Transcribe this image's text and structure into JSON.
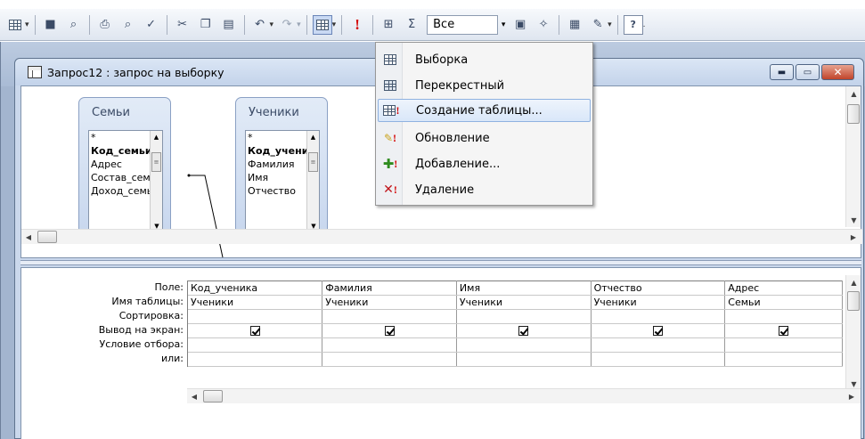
{
  "toolbar": {
    "combo_value": "Все",
    "sigma": "Σ",
    "exclaim": "!",
    "help": "?",
    "dropdown_arrow": "▾"
  },
  "menu": {
    "items": [
      {
        "label": "Выборка",
        "icon": "select-query-icon"
      },
      {
        "label": "Перекрестный",
        "icon": "crosstab-query-icon"
      },
      {
        "label": "Создание таблицы...",
        "icon": "make-table-query-icon"
      },
      {
        "label": "Обновление",
        "icon": "update-query-icon"
      },
      {
        "label": "Добавление...",
        "icon": "append-query-icon"
      },
      {
        "label": "Удаление",
        "icon": "delete-query-icon"
      }
    ],
    "highlighted_index": 2
  },
  "window": {
    "title": "Запрос12 : запрос на выборку",
    "minimize": "▬",
    "maximize": "▭",
    "close": "✕"
  },
  "tables": [
    {
      "name": "Семьи",
      "fields": [
        "*",
        "Код_семьи",
        "Адрес",
        "Состав_семьи",
        "Доход_семьи"
      ],
      "key_index": 1
    },
    {
      "name": "Ученики",
      "fields": [
        "*",
        "Код_ученика",
        "Фамилия",
        "Имя",
        "Отчество"
      ],
      "key_index": 1
    }
  ],
  "grid": {
    "row_labels": [
      "Поле:",
      "Имя таблицы:",
      "Сортировка:",
      "Вывод на экран:",
      "Условие отбора:",
      "или:"
    ],
    "columns": [
      {
        "field": "Код_ученика",
        "table": "Ученики",
        "show": true
      },
      {
        "field": "Фамилия",
        "table": "Ученики",
        "show": true
      },
      {
        "field": "Имя",
        "table": "Ученики",
        "show": true
      },
      {
        "field": "Отчество",
        "table": "Ученики",
        "show": true
      },
      {
        "field": "Адрес",
        "table": "Семьи",
        "show": true
      }
    ]
  }
}
